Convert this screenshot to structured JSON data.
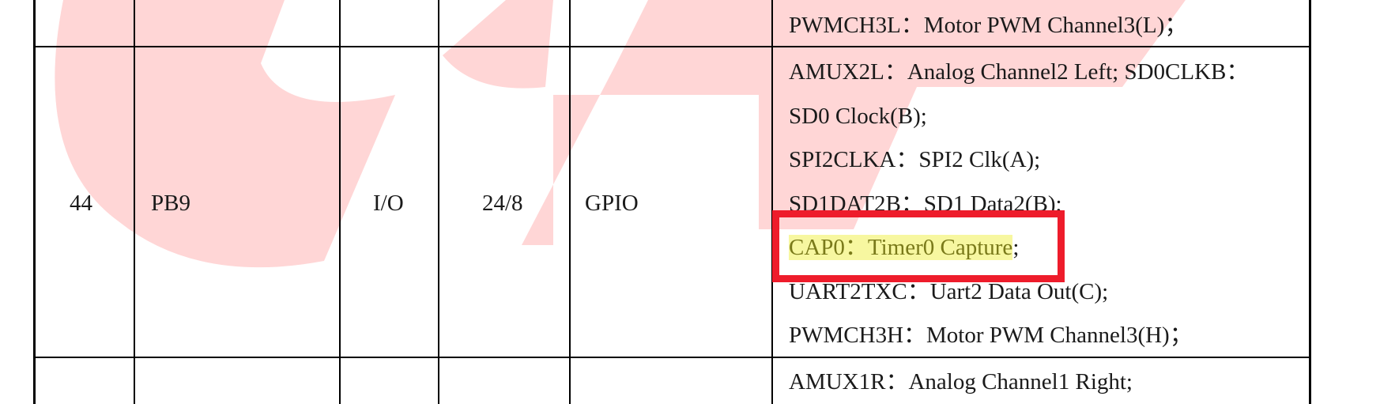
{
  "rows": [
    {
      "cells": [
        "",
        "",
        "",
        "",
        ""
      ],
      "functions": [
        "PWMCH3L：Motor PWM Channel3(L)；"
      ]
    },
    {
      "cells": [
        "44",
        "PB9",
        "I/O",
        "24/8",
        "GPIO"
      ],
      "functions": [
        "AMUX2L：Analog Channel2 Left; SD0CLKB：",
        "SD0 Clock(B);",
        "SPI2CLKA：SPI2 Clk(A);",
        "SD1DAT2B：SD1 Data2(B);",
        "CAP0：Timer0 Capture",
        "UART2TXC：Uart2 Data Out(C);",
        "PWMCH3H：Motor PWM Channel3(H)；"
      ],
      "highlight_suffix": ";"
    },
    {
      "cells": [
        "",
        "",
        "",
        "",
        ""
      ],
      "functions": [
        "AMUX1R：Analog Channel1 Right;"
      ]
    }
  ],
  "colors": {
    "watermark": "#ffd6d6",
    "highlight_bg": "#f7f7a0",
    "callout_border": "#ee1c2b",
    "grid": "#000000"
  }
}
